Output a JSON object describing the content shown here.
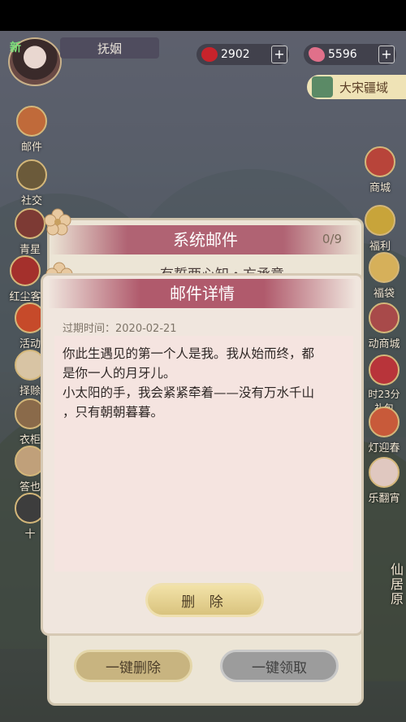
{
  "hud": {
    "new_tag": "新",
    "player_name": "抚姻",
    "resources": [
      {
        "icon": "ruby-icon",
        "value": "2902",
        "color": "#c8232b"
      },
      {
        "icon": "butterfly-icon",
        "value": "5596",
        "color": "#e0708a"
      }
    ],
    "plus": "+",
    "region": "大宋疆域"
  },
  "left_menu": [
    "邮件",
    "社交",
    "青星",
    "红尘客",
    "活动",
    "择赊",
    "衣柜",
    "答也",
    "十"
  ],
  "right_menu": [
    "商城",
    "福利",
    "福袋",
    "动商城",
    "时23分\n礼包",
    "灯迎春",
    "乐翻宵",
    "仙居原"
  ],
  "system_mail": {
    "title": "系统邮件",
    "count": "0/9",
    "first_item": "有誓两心知・方承意",
    "delete_all": "一键删除",
    "claim_all": "一键领取"
  },
  "detail": {
    "title": "邮件详情",
    "expiry": "过期时间：2020-02-21",
    "body_lines": [
      "你此生遇见的第一个人是我。我从始而终，都",
      "是你一人的月牙儿。",
      "小太阳的手，我会紧紧牵着——没有万水千山",
      "，只有朝朝暮暮。"
    ],
    "delete_button": "删 除"
  }
}
